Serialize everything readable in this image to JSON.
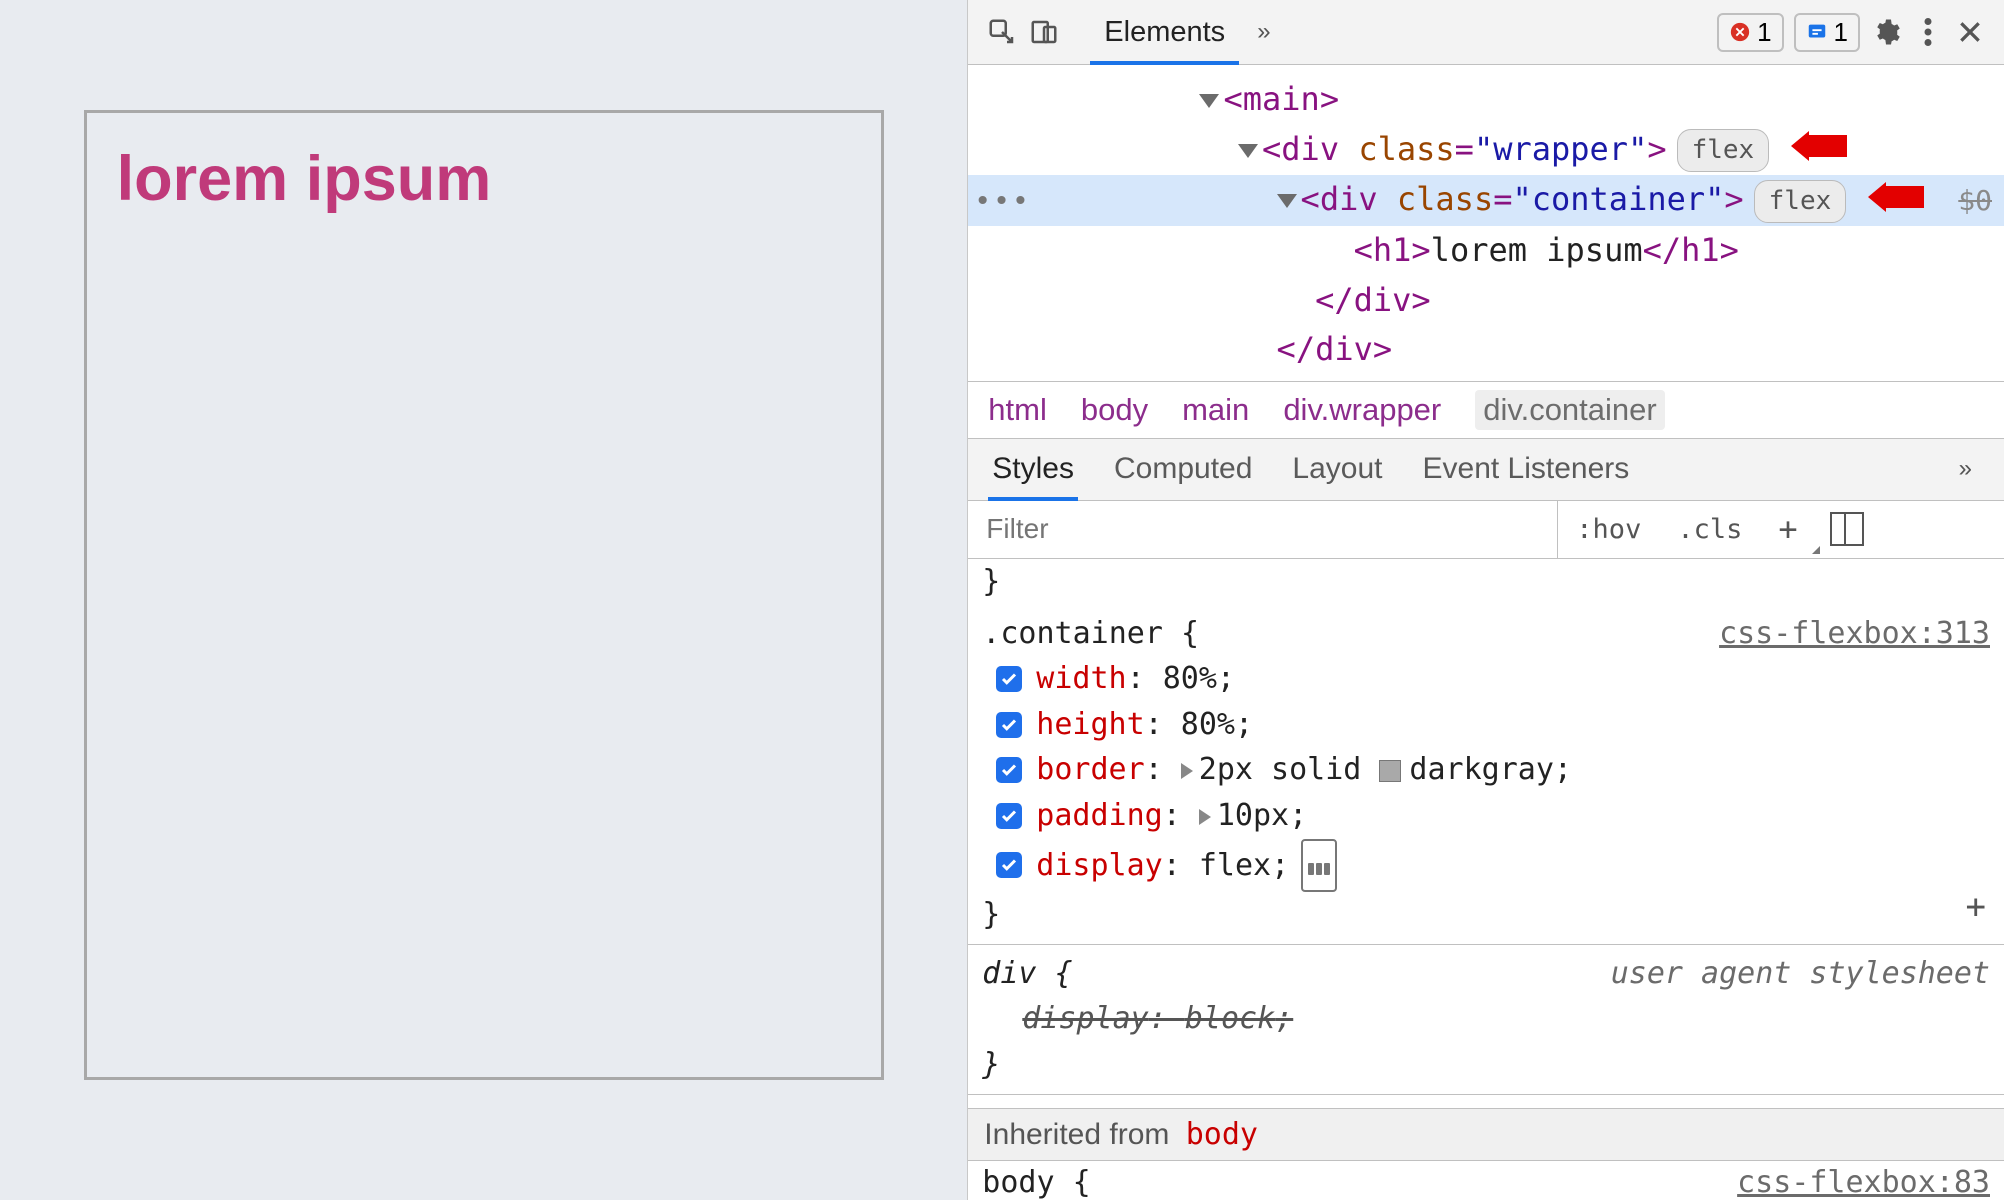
{
  "preview": {
    "heading": "lorem ipsum"
  },
  "toolbar": {
    "tabs": [
      "Elements"
    ],
    "errors_count": "1",
    "messages_count": "1"
  },
  "dom": {
    "l0": {
      "open": "<",
      "name": "main",
      "close": ">"
    },
    "l1": {
      "open": "<",
      "name": "div",
      "attr": "class",
      "val": "\"wrapper\"",
      "close": ">",
      "pill": "flex"
    },
    "l2": {
      "open": "<",
      "name": "div",
      "attr": "class",
      "val": "\"container\"",
      "close": ">",
      "pill": "flex",
      "dollar": "$0"
    },
    "l3": {
      "open": "<",
      "name": "h1",
      "text": "lorem ipsum",
      "closeTag": "</h1>"
    },
    "l4": "</div>",
    "l5": "</div>"
  },
  "breadcrumb": [
    "html",
    "body",
    "main",
    "div.wrapper",
    "div.container"
  ],
  "subtabs": [
    "Styles",
    "Computed",
    "Layout",
    "Event Listeners"
  ],
  "filter": {
    "placeholder": "Filter",
    "hov": ":hov",
    "cls": ".cls"
  },
  "rules": {
    "container": {
      "selector": ".container",
      "origin": "css-flexbox:313",
      "decls": [
        {
          "prop": "width",
          "val": "80%"
        },
        {
          "prop": "height",
          "val": "80%"
        },
        {
          "prop": "border",
          "val": "2px solid ",
          "swatchAfter": "darkgray",
          "expand": true
        },
        {
          "prop": "padding",
          "val": "10px",
          "expand": true
        },
        {
          "prop": "display",
          "val": "flex",
          "flexicon": true
        }
      ]
    },
    "div": {
      "selector": "div",
      "origin": "user agent stylesheet",
      "decls": [
        {
          "prop": "display",
          "val": "block",
          "struck": true
        }
      ]
    }
  },
  "inherited": {
    "label": "Inherited from",
    "from": "body"
  },
  "peek": {
    "sel": "body {",
    "src": "css-flexbox:83"
  }
}
